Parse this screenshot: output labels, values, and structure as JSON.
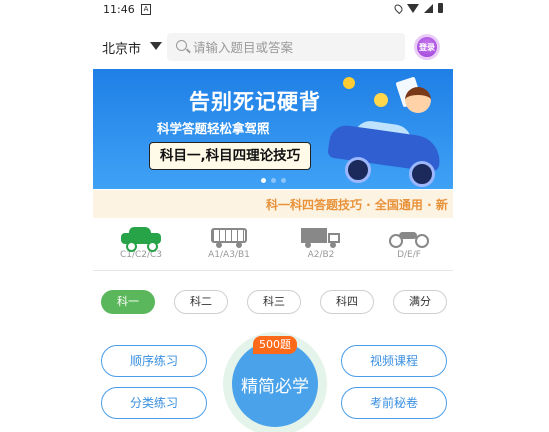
{
  "status": {
    "time": "11:46",
    "notif_glyph": "A"
  },
  "header": {
    "city": "北京市",
    "search_placeholder": "请输入题目或答案",
    "login_label": "登录"
  },
  "banner": {
    "title": "告别死记硬背",
    "subtitle": "科学答题轻松拿驾照",
    "pill": "科目一,科目四理论技巧",
    "active_dot": 0,
    "dot_count": 3
  },
  "marquee": {
    "text": "科一科四答题技巧 · 全国通用 · 新"
  },
  "license_types": [
    {
      "label": "C1/C2/C3",
      "icon": "car-icon",
      "active": true
    },
    {
      "label": "A1/A3/B1",
      "icon": "bus-icon",
      "active": false
    },
    {
      "label": "A2/B2",
      "icon": "truck-icon",
      "active": false
    },
    {
      "label": "D/E/F",
      "icon": "motorcycle-icon",
      "active": false
    }
  ],
  "subject_tabs": [
    "科一",
    "科二",
    "科三",
    "科四",
    "满分"
  ],
  "active_subject": 0,
  "practice": {
    "sequential": "顺序练习",
    "category": "分类练习",
    "video": "视频课程",
    "exam_secrets": "考前秘卷",
    "center_label": "精简必学",
    "center_badge": "500题"
  },
  "colors": {
    "accent_green": "#5bb75b",
    "accent_blue": "#4aa3ea",
    "badge_orange": "#ff6a1a",
    "marquee_text": "#e8923a"
  }
}
